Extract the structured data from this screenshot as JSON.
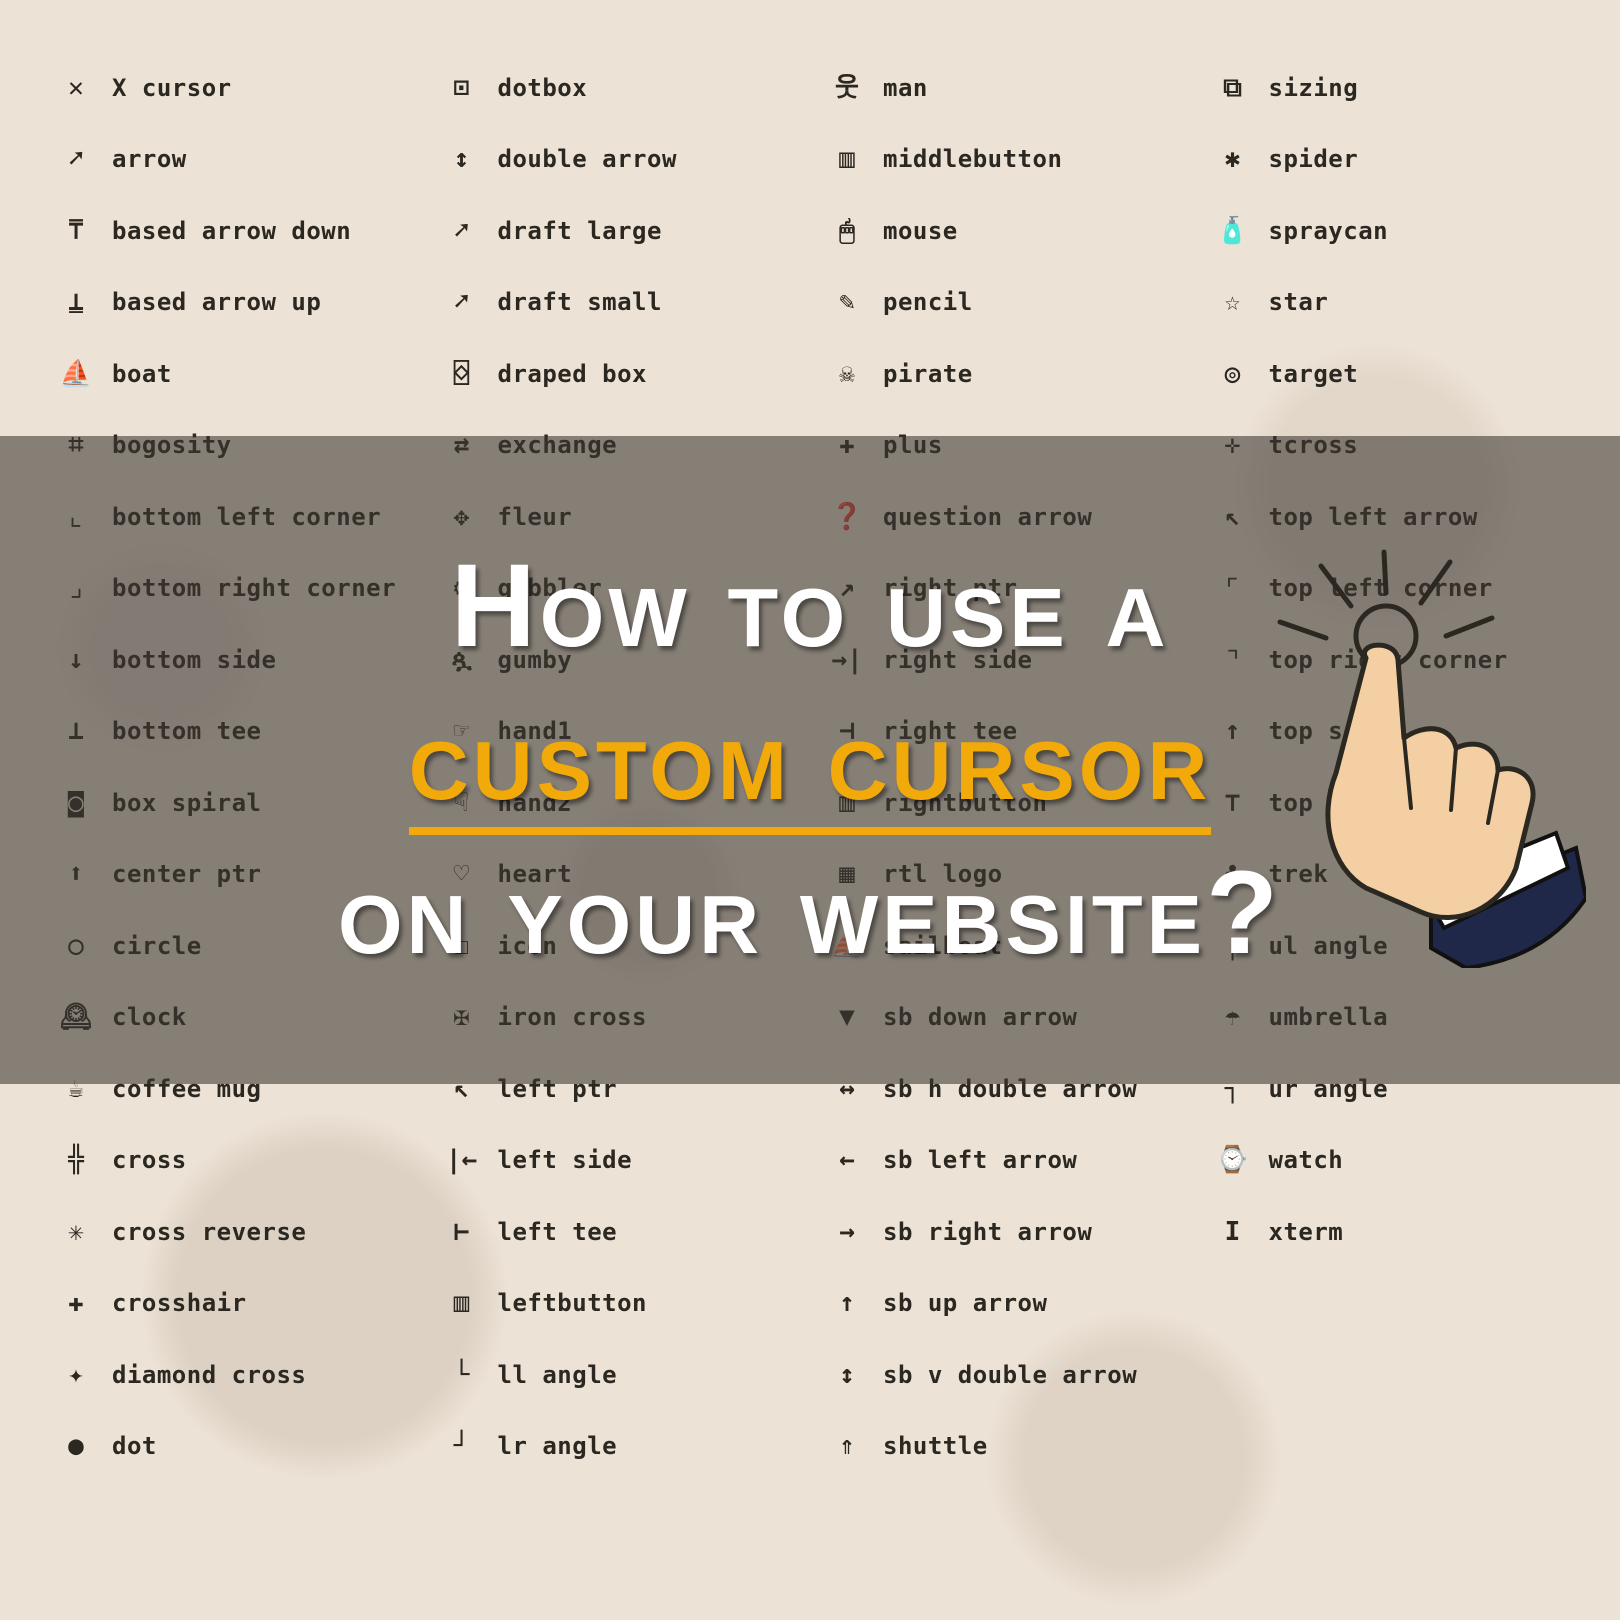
{
  "title": {
    "line1": "How to use a",
    "highlight": "custom cursor",
    "line3": "on your website?"
  },
  "columns": [
    [
      {
        "icon": "✕",
        "label": "X cursor"
      },
      {
        "icon": "➚",
        "label": "arrow"
      },
      {
        "icon": "⍑",
        "label": "based arrow down"
      },
      {
        "icon": "⍊",
        "label": "based arrow up"
      },
      {
        "icon": "⛵",
        "label": "boat"
      },
      {
        "icon": "⌗",
        "label": "bogosity"
      },
      {
        "icon": "⌞",
        "label": "bottom left corner"
      },
      {
        "icon": "⌟",
        "label": "bottom right corner"
      },
      {
        "icon": "↓",
        "label": "bottom side"
      },
      {
        "icon": "⟂",
        "label": "bottom tee"
      },
      {
        "icon": "◙",
        "label": "box spiral"
      },
      {
        "icon": "⬆",
        "label": "center ptr"
      },
      {
        "icon": "○",
        "label": "circle"
      },
      {
        "icon": "🕰",
        "label": "clock"
      },
      {
        "icon": "☕",
        "label": "coffee mug"
      },
      {
        "icon": "╬",
        "label": "cross"
      },
      {
        "icon": "✳",
        "label": "cross reverse"
      },
      {
        "icon": "✚",
        "label": "crosshair"
      },
      {
        "icon": "✦",
        "label": "diamond cross"
      },
      {
        "icon": "●",
        "label": "dot"
      }
    ],
    [
      {
        "icon": "⊡",
        "label": "dotbox"
      },
      {
        "icon": "↕",
        "label": "double arrow"
      },
      {
        "icon": "➚",
        "label": "draft large"
      },
      {
        "icon": "➚",
        "label": "draft small"
      },
      {
        "icon": "⌺",
        "label": "draped box"
      },
      {
        "icon": "⇄",
        "label": "exchange"
      },
      {
        "icon": "✥",
        "label": "fleur"
      },
      {
        "icon": "⚙",
        "label": "gobbler"
      },
      {
        "icon": "ጷ",
        "label": "gumby"
      },
      {
        "icon": "☞",
        "label": "hand1"
      },
      {
        "icon": "☟",
        "label": "hand2"
      },
      {
        "icon": "♡",
        "label": "heart"
      },
      {
        "icon": "☐",
        "label": "icon"
      },
      {
        "icon": "✠",
        "label": "iron cross"
      },
      {
        "icon": "↖",
        "label": "left ptr"
      },
      {
        "icon": "|←",
        "label": "left side"
      },
      {
        "icon": "⊢",
        "label": "left tee"
      },
      {
        "icon": "▥",
        "label": "leftbutton"
      },
      {
        "icon": "└",
        "label": "ll angle"
      },
      {
        "icon": "┘",
        "label": "lr angle"
      }
    ],
    [
      {
        "icon": "웃",
        "label": "man"
      },
      {
        "icon": "▥",
        "label": "middlebutton"
      },
      {
        "icon": "🖱",
        "label": "mouse"
      },
      {
        "icon": "✎",
        "label": "pencil"
      },
      {
        "icon": "☠",
        "label": "pirate"
      },
      {
        "icon": "✚",
        "label": "plus"
      },
      {
        "icon": "❓",
        "label": "question arrow"
      },
      {
        "icon": "↗",
        "label": "right ptr"
      },
      {
        "icon": "→|",
        "label": "right side"
      },
      {
        "icon": "⊣",
        "label": "right tee"
      },
      {
        "icon": "▥",
        "label": "rightbutton"
      },
      {
        "icon": "▦",
        "label": "rtl logo"
      },
      {
        "icon": "⛵",
        "label": "sailboat"
      },
      {
        "icon": "▼",
        "label": "sb down arrow"
      },
      {
        "icon": "↔",
        "label": "sb h double arrow"
      },
      {
        "icon": "←",
        "label": "sb left arrow"
      },
      {
        "icon": "→",
        "label": "sb right arrow"
      },
      {
        "icon": "↑",
        "label": "sb up arrow"
      },
      {
        "icon": "↕",
        "label": "sb v double arrow"
      },
      {
        "icon": "⇑",
        "label": "shuttle"
      }
    ],
    [
      {
        "icon": "⧉",
        "label": "sizing"
      },
      {
        "icon": "✱",
        "label": "spider"
      },
      {
        "icon": "🧴",
        "label": "spraycan"
      },
      {
        "icon": "☆",
        "label": "star"
      },
      {
        "icon": "◎",
        "label": "target"
      },
      {
        "icon": "✛",
        "label": "tcross"
      },
      {
        "icon": "↖",
        "label": "top left arrow"
      },
      {
        "icon": "⌜",
        "label": "top left corner"
      },
      {
        "icon": "⌝",
        "label": "top right corner"
      },
      {
        "icon": "↑",
        "label": "top side"
      },
      {
        "icon": "⊤",
        "label": "top tee"
      },
      {
        "icon": "♣",
        "label": "trek"
      },
      {
        "icon": "┌",
        "label": "ul angle"
      },
      {
        "icon": "☂",
        "label": "umbrella"
      },
      {
        "icon": "┐",
        "label": "ur angle"
      },
      {
        "icon": "⌚",
        "label": "watch"
      },
      {
        "icon": "I",
        "label": "xterm"
      }
    ]
  ]
}
